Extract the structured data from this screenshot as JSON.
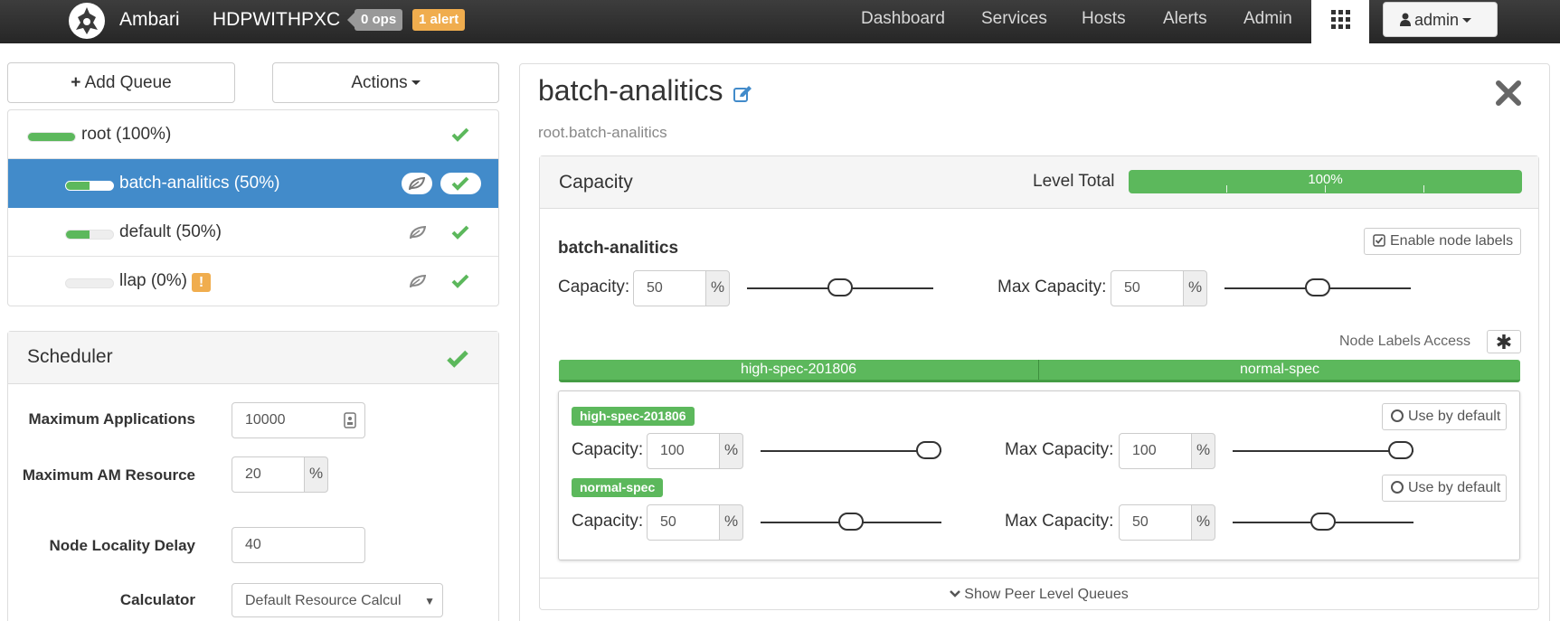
{
  "navbar": {
    "brand": "Ambari",
    "cluster": "HDPWITHPXC",
    "ops_badge": "0 ops",
    "alert_badge": "1 alert",
    "links": [
      "Dashboard",
      "Services",
      "Hosts",
      "Alerts",
      "Admin"
    ],
    "user": "admin"
  },
  "left": {
    "add_queue": "Add Queue",
    "actions": "Actions",
    "queues": [
      {
        "label": "root (100%)",
        "fill": 1.0
      },
      {
        "label": "batch-analitics (50%)",
        "fill": 0.5
      },
      {
        "label": "default (50%)",
        "fill": 0.5
      },
      {
        "label": "llap (0%)",
        "fill": 0.0,
        "warning": "!"
      }
    ],
    "scheduler": {
      "title": "Scheduler",
      "max_apps_label": "Maximum Applications",
      "max_apps_value": "10000",
      "max_am_label": "Maximum AM Resource",
      "max_am_value": "20",
      "percent": "%",
      "locality_label": "Node Locality Delay",
      "locality_value": "40",
      "calculator_label": "Calculator",
      "calculator_value": "Default Resource Calcul"
    }
  },
  "queue": {
    "title": "batch-analitics",
    "path": "root.batch-analitics",
    "capacity": {
      "title": "Capacity",
      "level_total_label": "Level Total",
      "level_total_value": "100%",
      "level_total_fill": 1.0,
      "section_title": "batch-analitics",
      "enable_node_labels": "Enable node labels",
      "capacity_label": "Capacity:",
      "capacity_value": "50",
      "max_capacity_label": "Max Capacity:",
      "max_capacity_value": "50",
      "percent": "%",
      "node_labels_access": "Node Labels Access",
      "node_labels_access_value": "✱",
      "node_label_bar": [
        "high-spec-201806",
        "normal-spec"
      ],
      "labels": [
        {
          "name": "high-spec-201806",
          "use_default": "Use by default",
          "capacity_label": "Capacity:",
          "capacity": "100",
          "max_label": "Max Capacity:",
          "max_capacity": "100"
        },
        {
          "name": "normal-spec",
          "use_default": "Use by default",
          "capacity_label": "Capacity:",
          "capacity": "50",
          "max_label": "Max Capacity:",
          "max_capacity": "50"
        }
      ],
      "show_peer": "Show Peer Level Queues"
    }
  },
  "colors": {
    "green": "#5cb85c",
    "blue": "#428bca",
    "orange": "#f0ad4e",
    "navbar": "#2f2f2f"
  }
}
